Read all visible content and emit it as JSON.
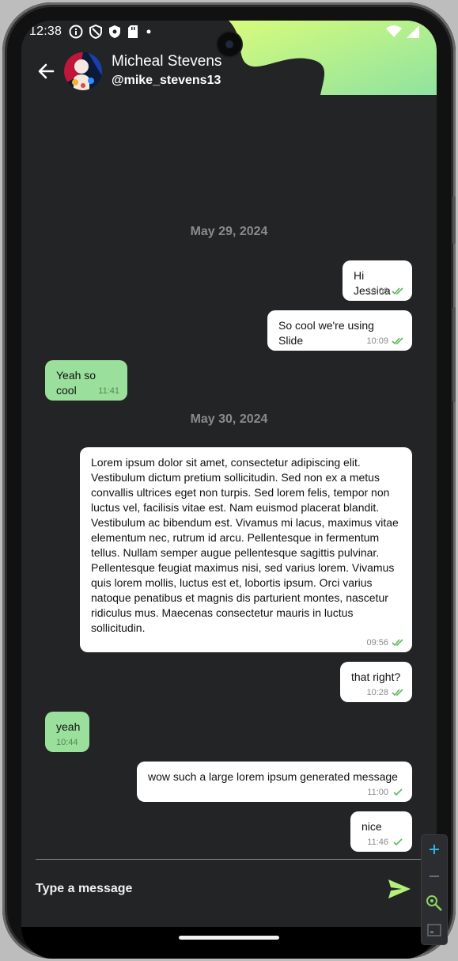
{
  "status_bar": {
    "time": "12:38"
  },
  "header": {
    "back_icon": "arrow-left-icon",
    "contact_name": "Micheal Stevens",
    "contact_handle": "@mike_stevens13",
    "accent_gradient": [
      "#d7fb7c",
      "#8fe3a0"
    ]
  },
  "messages": {
    "date_1": "May 29, 2024",
    "date_2": "May 30, 2024",
    "items": [
      {
        "direction": "out",
        "text": "Hi Jessica",
        "time": "10:08",
        "status": "read"
      },
      {
        "direction": "out",
        "text": "So cool we're using Slide",
        "time": "10:09",
        "status": "read"
      },
      {
        "direction": "in",
        "text": "Yeah so cool",
        "time": "11:41"
      },
      {
        "direction": "out",
        "text": "Lorem ipsum dolor sit amet, consectetur adipiscing elit. Vestibulum dictum pretium sollicitudin. Sed non ex a metus convallis ultrices eget non turpis. Sed lorem felis, tempor non luctus vel, facilisis vitae est. Nam euismod placerat blandit. Vestibulum ac bibendum est. Vivamus mi lacus, maximus vitae elementum nec, rutrum id arcu. Pellentesque in fermentum tellus. Nullam semper augue pellentesque sagittis pulvinar. Pellentesque feugiat maximus nisi, sed varius lorem. Vivamus quis lorem mollis, luctus est et, lobortis ipsum. Orci varius natoque penatibus et magnis dis parturient montes, nascetur ridiculus mus. Maecenas consectetur mauris in luctus sollicitudin.",
        "time": "09:56",
        "status": "read"
      },
      {
        "direction": "out",
        "text": "that right?",
        "time": "10:28",
        "status": "read"
      },
      {
        "direction": "in",
        "text": "yeah",
        "time": "10:44"
      },
      {
        "direction": "out",
        "text": "wow such a large lorem ipsum generated message",
        "time": "11:00",
        "status": "sent"
      },
      {
        "direction": "out",
        "text": "nice",
        "time": "11:46",
        "status": "sent"
      }
    ]
  },
  "composer": {
    "placeholder": "Type a message",
    "send_icon": "send-icon"
  },
  "zoom_controls": [
    "zoom-in-icon",
    "zoom-out-icon",
    "zoom-reset-icon",
    "fit-screen-icon"
  ],
  "colors": {
    "background": "#232426",
    "outgoing_bubble": "#ffffff",
    "incoming_bubble": "#9adf9c",
    "read_check": "#5cb85c",
    "send_icon": "#b6f07c"
  }
}
